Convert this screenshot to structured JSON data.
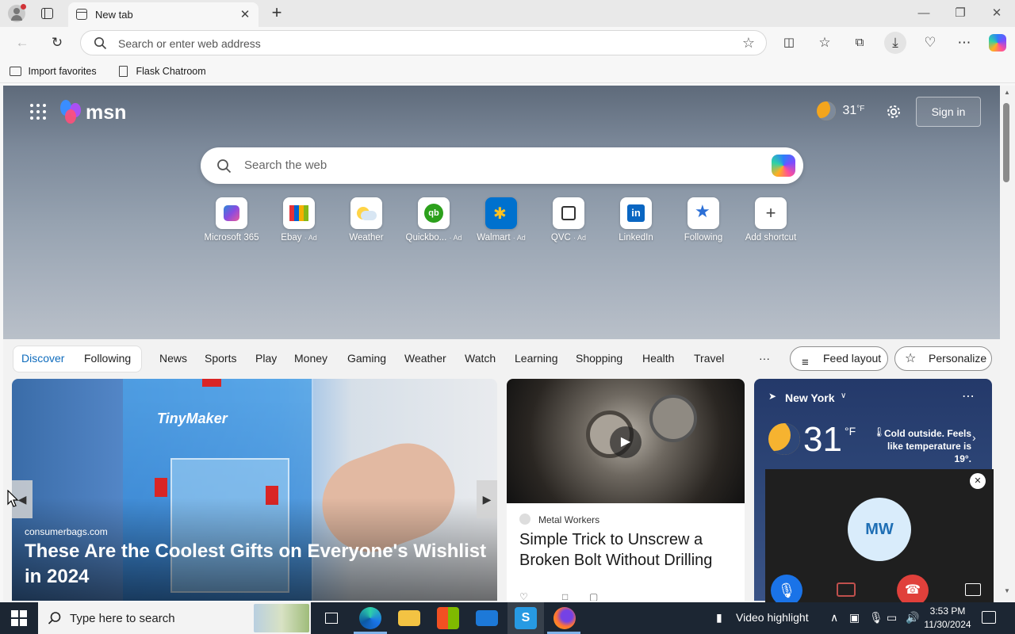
{
  "browser": {
    "tab_title": "New tab",
    "address_placeholder": "Search or enter web address",
    "bookmarks": [
      "Import favorites",
      "Flask Chatroom"
    ]
  },
  "msn": {
    "logo_text": "msn",
    "weather_temp": "31",
    "weather_unit": "°F",
    "sign_in": "Sign in",
    "search_placeholder": "Search the web",
    "shortcuts": [
      {
        "label": "Microsoft 365",
        "ad": ""
      },
      {
        "label": "Ebay",
        "ad": "· Ad"
      },
      {
        "label": "Weather",
        "ad": ""
      },
      {
        "label": "Quickbo...",
        "ad": "· Ad"
      },
      {
        "label": "Walmart",
        "ad": "· Ad"
      },
      {
        "label": "QVC",
        "ad": "· Ad"
      },
      {
        "label": "LinkedIn",
        "ad": ""
      },
      {
        "label": "Following",
        "ad": ""
      },
      {
        "label": "Add shortcut",
        "ad": ""
      }
    ],
    "feed_tabs": [
      "Discover",
      "Following"
    ],
    "nav_items": [
      "News",
      "Sports",
      "Play",
      "Money",
      "Gaming",
      "Weather",
      "Watch",
      "Learning",
      "Shopping",
      "Health",
      "Travel"
    ],
    "more": "···",
    "feed_layout": "Feed layout",
    "personalize": "Personalize"
  },
  "cards": {
    "main": {
      "image_text": "TinyMaker",
      "source": "consumerbags.com",
      "title": "These Are the Coolest Gifts on Everyone's Wishlist in 2024"
    },
    "second": {
      "source": "Metal Workers",
      "title": "Simple Trick to Unscrew a Broken Bolt Without Drilling"
    },
    "weather": {
      "location": "New York",
      "temp": "31",
      "unit": "°F",
      "desc": "Cold outside. Feels like temperature is 19°."
    }
  },
  "call": {
    "initials": "MW"
  },
  "taskbar": {
    "search_placeholder": "Type here to search",
    "video_highlight": "Video highlight",
    "time": "3:53 PM",
    "date": "11/30/2024"
  },
  "colors": {
    "accent_blue": "#0f6cbd",
    "call_end": "#e0403b",
    "call_mic": "#1a73e8"
  }
}
